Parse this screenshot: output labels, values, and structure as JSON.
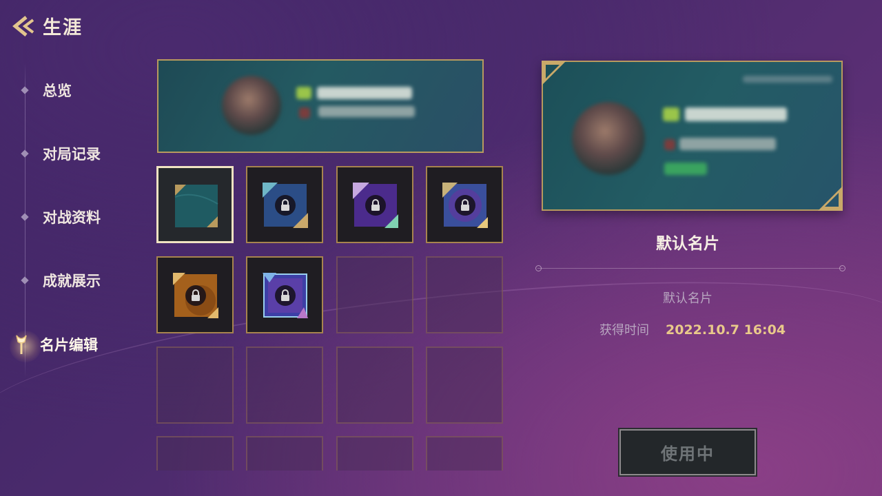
{
  "header": {
    "title": "生涯"
  },
  "sidebar": {
    "items": [
      {
        "label": "总览"
      },
      {
        "label": "对局记录"
      },
      {
        "label": "对战资料"
      },
      {
        "label": "成就展示"
      },
      {
        "label": "名片编辑",
        "active": true
      }
    ]
  },
  "grid": {
    "slots": [
      {
        "state": "selected",
        "theme": "teal-default"
      },
      {
        "state": "locked",
        "theme": "blue-dragon"
      },
      {
        "state": "locked",
        "theme": "purple-floral"
      },
      {
        "state": "locked",
        "theme": "cosmic-violet"
      },
      {
        "state": "locked",
        "theme": "amber-gold"
      },
      {
        "state": "locked",
        "theme": "neon-blue-purple"
      },
      {
        "state": "empty"
      },
      {
        "state": "empty"
      },
      {
        "state": "empty"
      },
      {
        "state": "empty"
      },
      {
        "state": "empty"
      },
      {
        "state": "empty"
      },
      {
        "state": "empty"
      },
      {
        "state": "empty"
      },
      {
        "state": "empty"
      },
      {
        "state": "empty"
      }
    ]
  },
  "preview": {
    "name": "默认名片",
    "description": "默认名片",
    "obtain_label": "获得时间",
    "obtain_value": "2022.10.7  16:04",
    "button_label": "使用中"
  },
  "colors": {
    "gold_border": "#b89a5e",
    "accent_text": "#e9c98a",
    "background": "#4a2a6c"
  }
}
